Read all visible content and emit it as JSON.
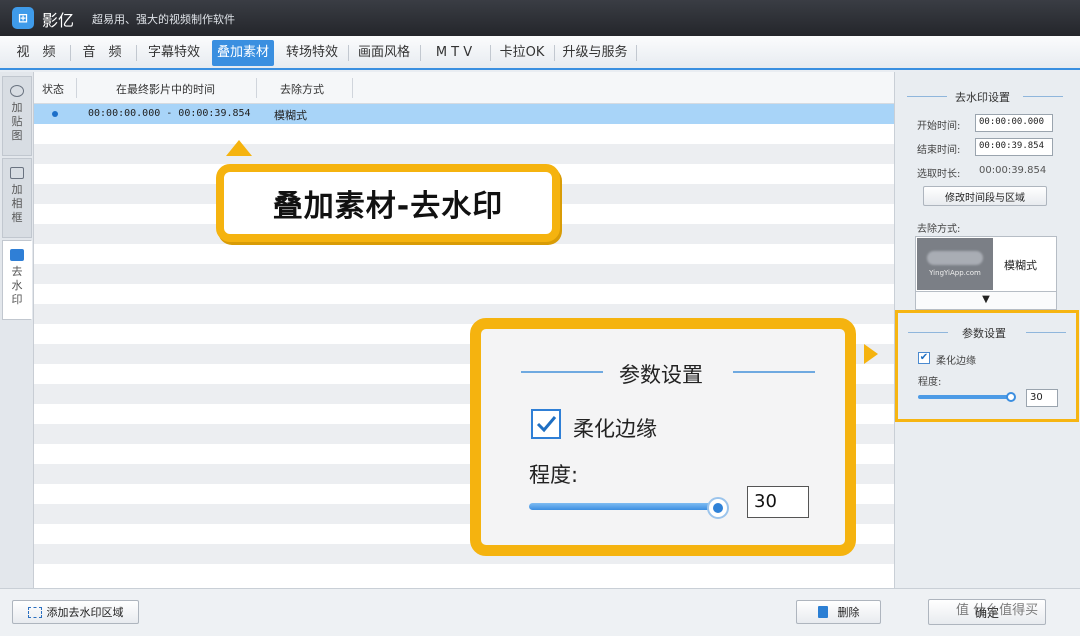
{
  "app": {
    "name": "影亿",
    "tagline": "超易用、强大的视频制作软件",
    "accent": "#3a8fe0",
    "highlight": "#f5b30f"
  },
  "menu": {
    "tabs": [
      {
        "label": "视　频"
      },
      {
        "label": "音　频"
      },
      {
        "label": "字幕特效"
      },
      {
        "label": "叠加素材",
        "active": true
      },
      {
        "label": "转场特效"
      },
      {
        "label": "画面风格"
      },
      {
        "label": "M T V"
      },
      {
        "label": "卡拉OK"
      },
      {
        "label": "升级与服务"
      }
    ]
  },
  "sidetabs": [
    {
      "label": "加贴图",
      "icon": "sticker-icon"
    },
    {
      "label": "加相框",
      "icon": "frame-icon"
    },
    {
      "label": "去水印",
      "icon": "watermark-icon",
      "active": true
    }
  ],
  "table": {
    "columns": [
      "状态",
      "在最终影片中的时间",
      "去除方式"
    ],
    "rows": [
      {
        "time": "00:00:00.000 - 00:00:39.854",
        "mode": "模糊式",
        "selected": true
      }
    ]
  },
  "right": {
    "section_title": "去水印设置",
    "start_label": "开始时间:",
    "start_value": "00:00:00.000",
    "end_label": "结束时间:",
    "end_value": "00:00:39.854",
    "duration_label": "选取时长:",
    "duration_value": "00:00:39.854",
    "modify_button": "修改时间段与区域",
    "mode_label": "去除方式:",
    "mode_value": "模糊式",
    "mode_thumb_text": "YingYiApp.com",
    "dropdown_arrow": "▼",
    "param_title": "参数设置",
    "soften_label": "柔化边缘",
    "soften_checked": true,
    "degree_label": "程度:",
    "degree_value": "30",
    "degree_level": 1.0
  },
  "callouts": {
    "main": "叠加素材-去水印",
    "param_title": "参数设置",
    "soften_label": "柔化边缘",
    "degree_label": "程度:",
    "degree_value": "30"
  },
  "bottom": {
    "add_button": "添加去水印区域",
    "delete_button": "删除",
    "ok_button": "确定",
    "watermark": "值 什么值得买"
  }
}
